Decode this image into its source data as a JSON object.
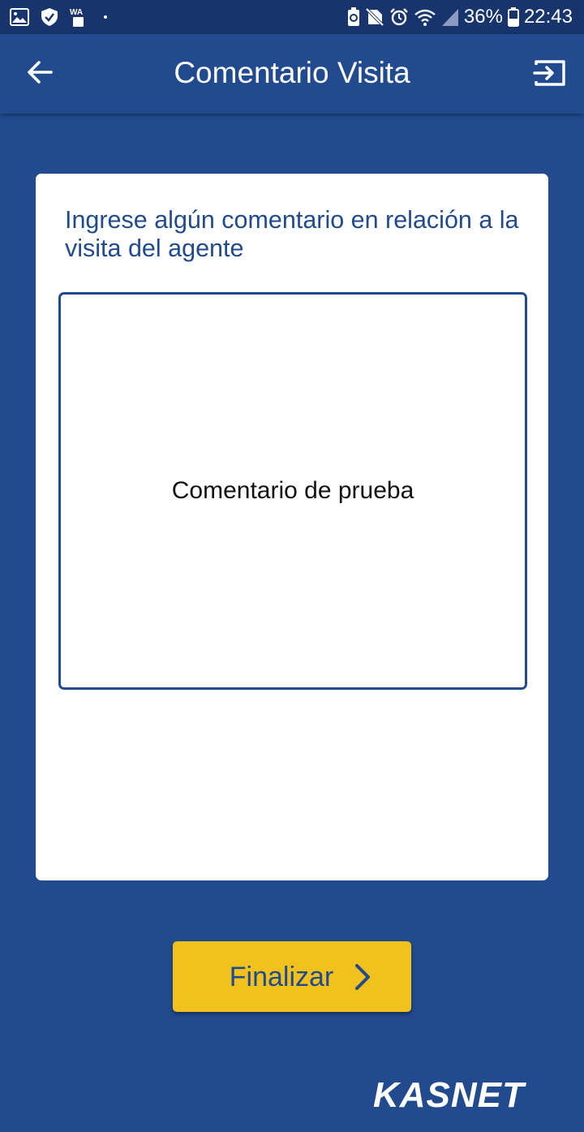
{
  "status_bar": {
    "icons_left": [
      "gallery-icon",
      "shield-icon",
      "whatsapp-icon"
    ],
    "icons_right": [
      "battery-saver-icon",
      "no-sim-icon",
      "alarm-icon",
      "wifi-icon",
      "signal-icon",
      "battery-icon"
    ],
    "battery_percent": "36%",
    "time": "22:43"
  },
  "header": {
    "title": "Comentario Visita",
    "back_icon": "arrow-left-icon",
    "logout_icon": "logout-icon"
  },
  "form": {
    "prompt": "Ingrese algún comentario en relación a la visita del agente",
    "comment_value": "Comentario de prueba"
  },
  "actions": {
    "finalize_label": "Finalizar",
    "finalize_icon": "chevron-right-icon"
  },
  "brand": {
    "logo_text": "KASNET"
  },
  "colors": {
    "primary": "#224a8e",
    "status_bar": "#17356c",
    "accent": "#f1c21d",
    "card": "#ffffff"
  }
}
